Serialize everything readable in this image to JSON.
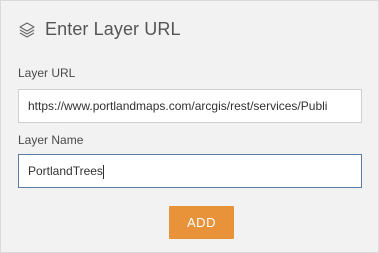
{
  "header": {
    "title": "Enter Layer URL",
    "icon": "layers-icon"
  },
  "layer_url": {
    "label": "Layer URL",
    "value": "https://www.portlandmaps.com/arcgis/rest/services/Publi"
  },
  "layer_name": {
    "label": "Layer Name",
    "value": "PortlandTrees"
  },
  "actions": {
    "add_label": "ADD"
  },
  "colors": {
    "accent": "#e8923a",
    "panel_bg": "#f2f2f2",
    "focus_border": "#5b7fa3"
  }
}
